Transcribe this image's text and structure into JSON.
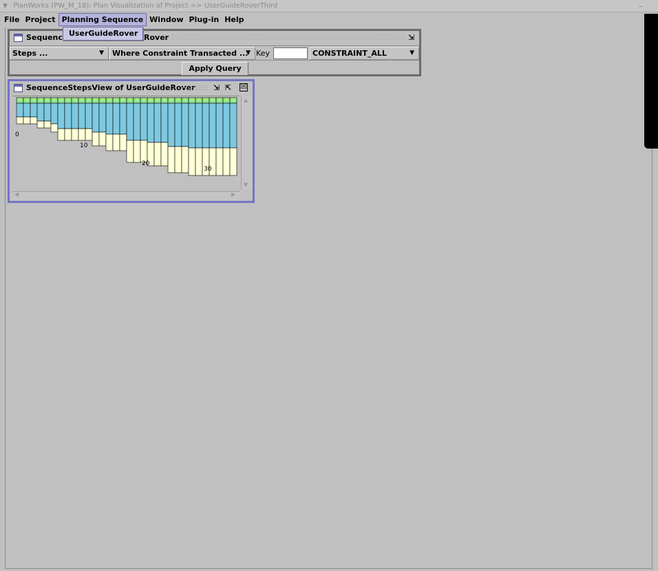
{
  "window": {
    "title": "PlanWorks (PW_M_18): Plan Visualization of Project =>  UserGuideRoverThird",
    "minimize_glyph": "–"
  },
  "menubar": {
    "items": [
      "File",
      "Project",
      "Planning Sequence",
      "Window",
      "Plug-in",
      "Help"
    ],
    "active": "Planning Sequence"
  },
  "dropdown": {
    "items": [
      "UserGuideRover"
    ]
  },
  "query_frame": {
    "title_start": "Sequence",
    "title_end": "Rover",
    "steps_combo": "Steps ...",
    "where_combo": "Where Constraint Transacted ...",
    "key_label": "Key",
    "key_value": "",
    "constraint_combo": "CONSTRAINT_ALL",
    "apply_label": "Apply Query"
  },
  "steps_frame": {
    "title": "SequenceStepsView of UserGuideRover",
    "close_glyph": "☒"
  },
  "chart_data": {
    "type": "bar",
    "description_of_bars": "stacked step bars",
    "x_tick_labels": [
      "0",
      "10",
      "20",
      "30"
    ],
    "step_count": 32,
    "colors": {
      "top_strip": "#90e890",
      "top_dots": "#e8e860",
      "middle": "#7ec8e0",
      "bottom": "#ffffd8"
    },
    "series": [
      {
        "values": [
          25,
          25,
          25,
          25,
          25,
          25,
          25,
          25,
          25,
          25,
          25,
          25,
          25,
          25,
          25,
          25,
          25,
          25,
          25,
          25,
          25,
          25,
          25,
          25,
          25,
          25,
          25,
          25,
          25,
          25,
          25,
          25
        ]
      },
      {
        "values": [
          28,
          28,
          28,
          34,
          34,
          38,
          45,
          45,
          45,
          45,
          45,
          50,
          50,
          53,
          53,
          53,
          62,
          62,
          62,
          65,
          65,
          65,
          71,
          71,
          71,
          73,
          73,
          73,
          73,
          73,
          73,
          73
        ]
      },
      {
        "values": [
          10,
          10,
          10,
          10,
          10,
          12,
          17,
          17,
          17,
          17,
          17,
          20,
          20,
          24,
          24,
          24,
          32,
          32,
          32,
          34,
          34,
          34,
          38,
          38,
          38,
          40,
          40,
          40,
          40,
          40,
          40,
          40
        ]
      }
    ]
  }
}
